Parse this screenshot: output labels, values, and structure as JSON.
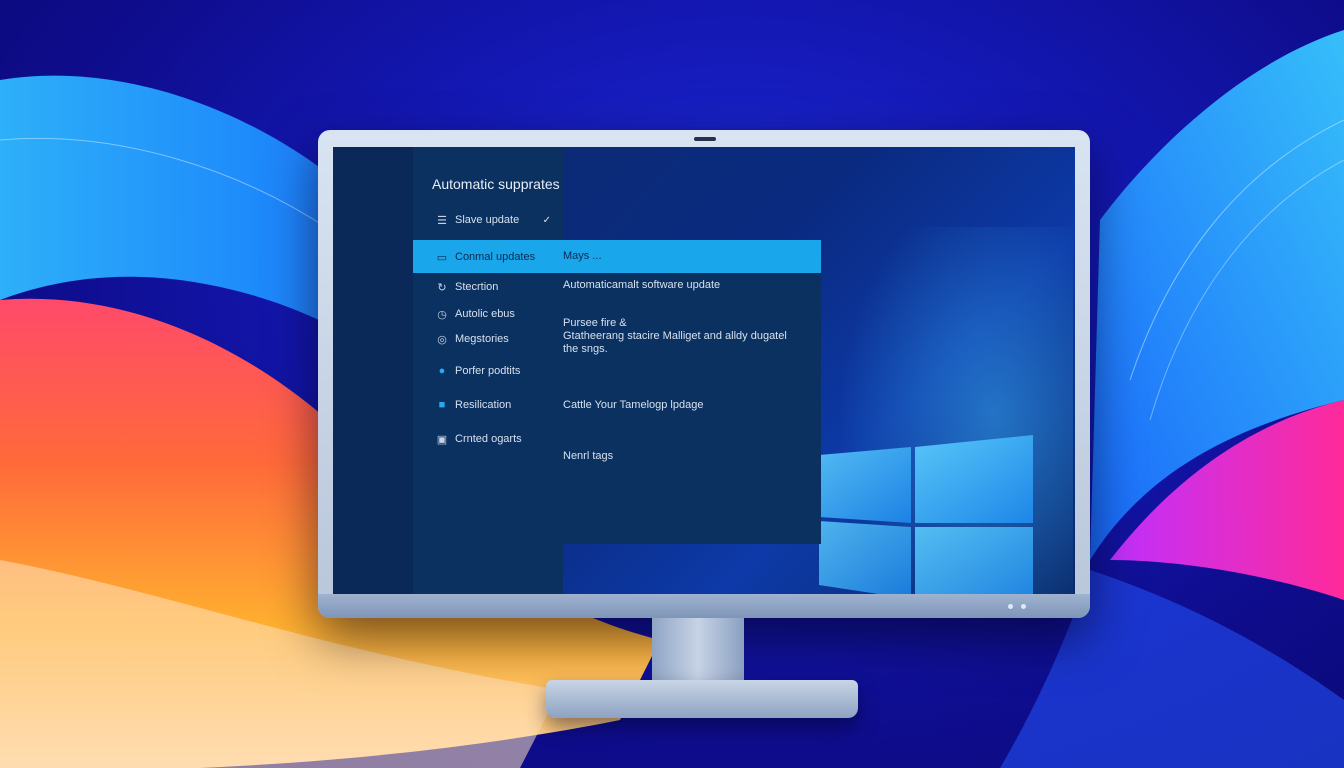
{
  "sidebar": {
    "title": "Automatic supprates",
    "items": [
      {
        "label": "Slave update",
        "icon": "list-icon",
        "checked": true
      },
      {
        "label": "Conmal updates",
        "icon": "clipboard-icon",
        "selected": true
      },
      {
        "label": "Stecrtion",
        "icon": "refresh-icon"
      },
      {
        "label": "Autolic ebus",
        "icon": "clock-icon"
      },
      {
        "label": "Megstories",
        "icon": "circle-icon"
      },
      {
        "label": "Porfer podtits",
        "icon": "location-pin-icon"
      },
      {
        "label": "Resilication",
        "icon": "folder-icon"
      },
      {
        "label": "Crnted ogarts",
        "icon": "window-icon"
      }
    ]
  },
  "panel": {
    "header": "Mays ...",
    "lines": [
      "Automaticamalt software update",
      "Pursee fire &",
      "Gtatheerang stacire Malliget and alldy dugatel",
      "the sngs.",
      "Cattle Your Tamelogp lpdage",
      "Nenrl tags"
    ]
  },
  "colors": {
    "selection": "#1aa6ea",
    "sidebar_bg": "#0b3160",
    "desktop_bg": "#0d2f7a"
  }
}
